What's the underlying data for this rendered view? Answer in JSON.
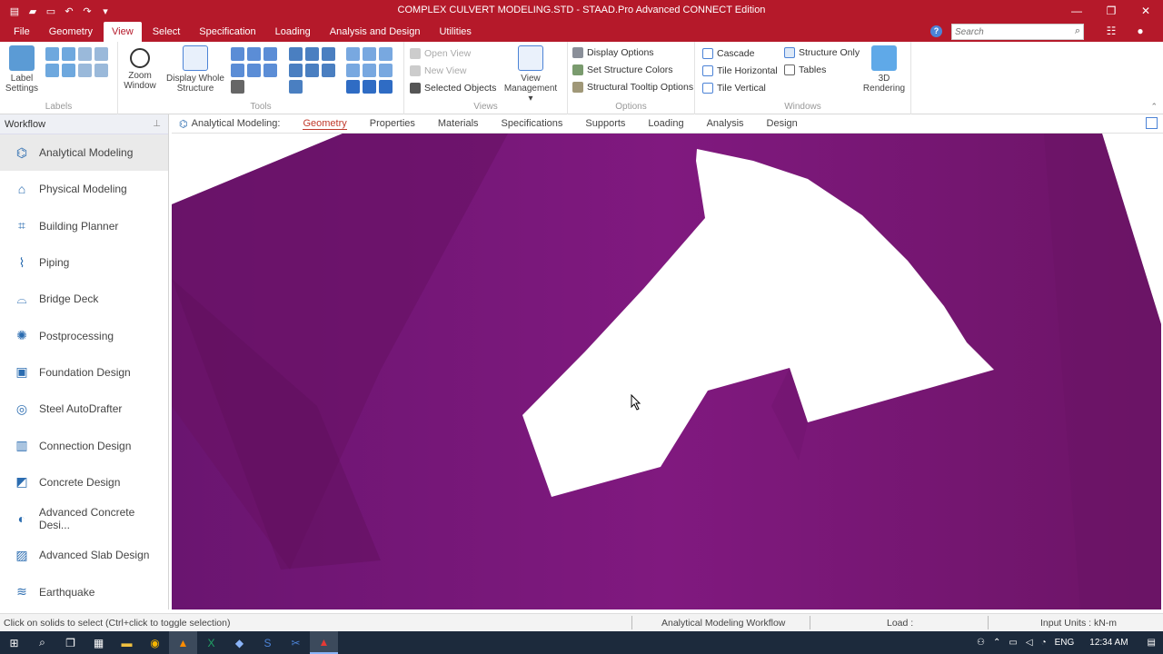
{
  "window": {
    "title": "COMPLEX CULVERT MODELING.STD - STAAD.Pro Advanced CONNECT Edition",
    "quick_access_icons": [
      "app-menu-icon",
      "open-folder-icon",
      "folder-icon",
      "undo-icon",
      "redo-icon",
      "dropdown-icon"
    ],
    "controls": [
      "minimize-icon",
      "restore-icon",
      "close-icon"
    ]
  },
  "menu": {
    "tabs": [
      "File",
      "Geometry",
      "View",
      "Select",
      "Specification",
      "Loading",
      "Analysis and Design",
      "Utilities"
    ],
    "active_tab": "View",
    "search_placeholder": "Search"
  },
  "ribbon": {
    "labels": {
      "group": "Labels",
      "label_settings": "Label Settings"
    },
    "tools": {
      "group": "Tools",
      "zoom_window": "Zoom Window",
      "display_whole_structure": "Display Whole Structure"
    },
    "views": {
      "group": "Views",
      "open_view": "Open View",
      "new_view": "New View",
      "selected_objects": "Selected Objects",
      "view_management": "View Management"
    },
    "options": {
      "group": "Options",
      "display_options": "Display Options",
      "set_structure_colors": "Set Structure Colors",
      "structural_tooltip_options": "Structural Tooltip Options"
    },
    "windows": {
      "group": "Windows",
      "cascade": "Cascade",
      "tile_horizontal": "Tile Horizontal",
      "tile_vertical": "Tile Vertical",
      "structure_only": "Structure Only",
      "tables": "Tables",
      "rendering_3d": "3D Rendering"
    }
  },
  "workflow": {
    "header": "Workflow",
    "items": [
      {
        "label": "Analytical Modeling",
        "icon": "analytical-modeling-icon",
        "active": true
      },
      {
        "label": "Physical Modeling",
        "icon": "physical-modeling-icon"
      },
      {
        "label": "Building Planner",
        "icon": "building-planner-icon"
      },
      {
        "label": "Piping",
        "icon": "piping-icon"
      },
      {
        "label": "Bridge Deck",
        "icon": "bridge-deck-icon"
      },
      {
        "label": "Postprocessing",
        "icon": "postprocessing-icon"
      },
      {
        "label": "Foundation Design",
        "icon": "foundation-design-icon"
      },
      {
        "label": "Steel AutoDrafter",
        "icon": "steel-autodrafter-icon"
      },
      {
        "label": "Connection Design",
        "icon": "connection-design-icon"
      },
      {
        "label": "Concrete Design",
        "icon": "concrete-design-icon"
      },
      {
        "label": "Advanced Concrete Desi...",
        "icon": "advanced-concrete-design-icon"
      },
      {
        "label": "Advanced Slab Design",
        "icon": "advanced-slab-design-icon"
      },
      {
        "label": "Earthquake",
        "icon": "earthquake-icon"
      }
    ]
  },
  "subtoolbar": {
    "lead": "Analytical Modeling:",
    "tabs": [
      "Geometry",
      "Properties",
      "Materials",
      "Specifications",
      "Supports",
      "Loading",
      "Analysis",
      "Design"
    ],
    "active": "Geometry"
  },
  "viewport": {
    "background_color": "#7a1a7e",
    "shape_color": "#ffffff"
  },
  "status": {
    "hint": "Click on solids to select (Ctrl+click to toggle selection)",
    "workflow": "Analytical Modeling Workflow",
    "load": "Load :",
    "units": "Input Units : kN-m"
  },
  "taskbar": {
    "apps": [
      "start-icon",
      "search-icon",
      "task-view-icon",
      "calculator-icon",
      "file-explorer-icon",
      "chrome-icon",
      "vlc-icon",
      "excel-icon",
      "app-icon",
      "staad-icon",
      "snipping-icon",
      "bentley-icon"
    ],
    "language": "ENG",
    "time": "12:34 AM"
  }
}
